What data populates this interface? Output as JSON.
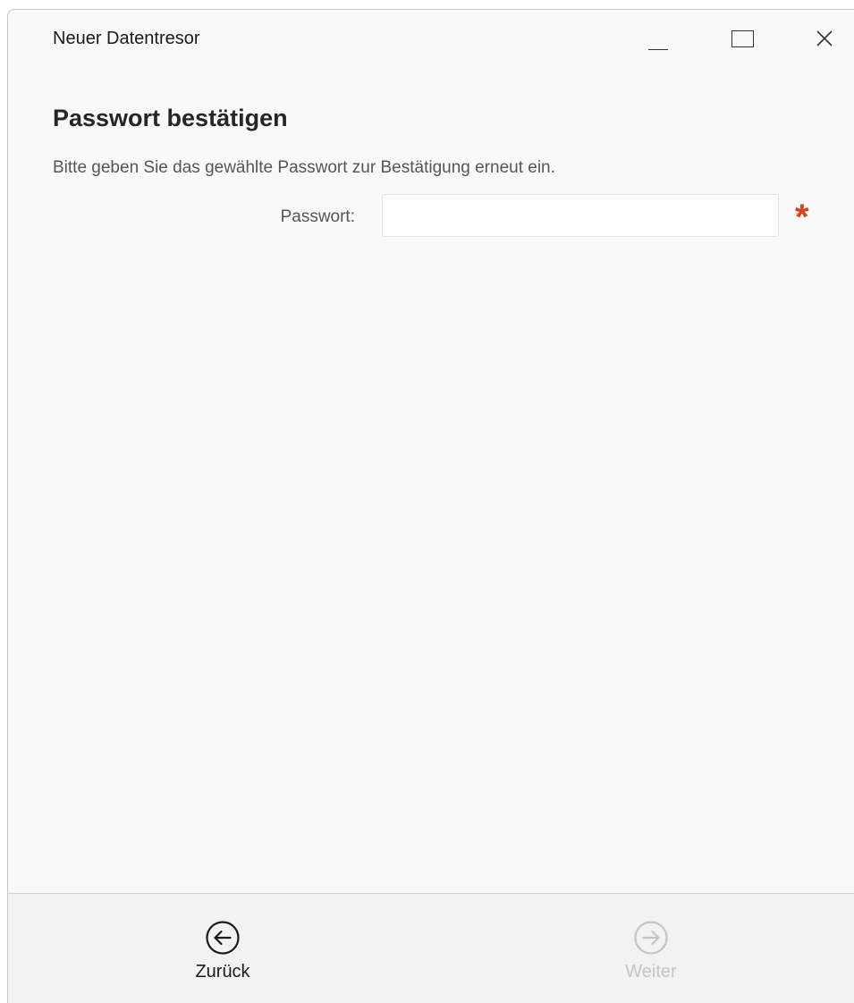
{
  "window": {
    "title": "Neuer Datentresor",
    "controls": {
      "minimize_icon": "minimize-icon",
      "maximize_icon": "maximize-icon",
      "close_icon": "close-icon"
    }
  },
  "page": {
    "heading": "Passwort bestätigen",
    "description": "Bitte geben Sie das gewählte Passwort zur Bestätigung erneut ein.",
    "password_field": {
      "label": "Passwort:",
      "value": "",
      "placeholder": "",
      "required_marker": "*"
    }
  },
  "footer": {
    "back": {
      "label": "Zurück",
      "icon": "arrow-left-circle-icon",
      "enabled": true
    },
    "next": {
      "label": "Weiter",
      "icon": "arrow-right-circle-icon",
      "enabled": false
    }
  },
  "colors": {
    "background": "#f9f9f9",
    "footer_background": "#f2f2f2",
    "required_marker": "#d2461e",
    "disabled_text": "#c4c4c4"
  }
}
